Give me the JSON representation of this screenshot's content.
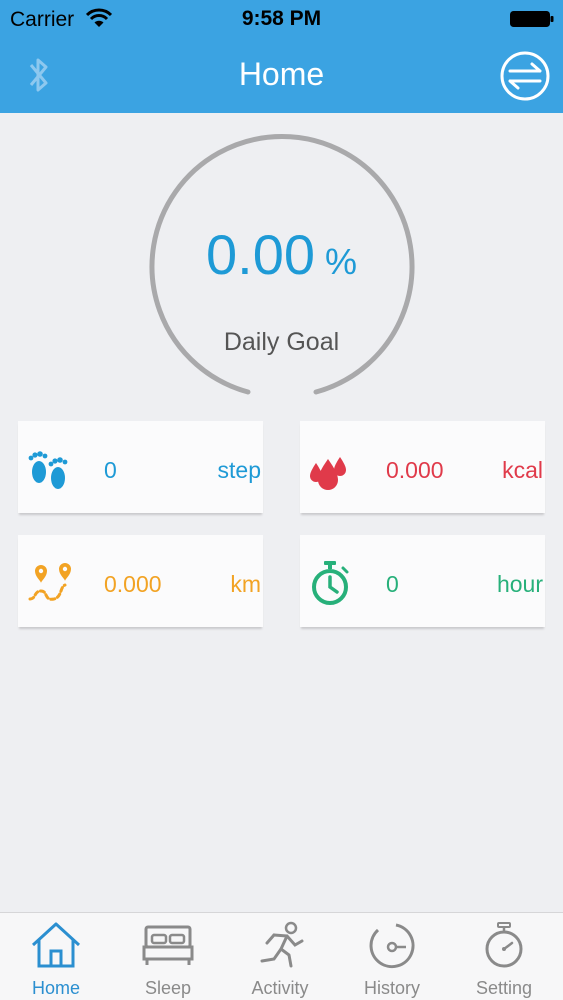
{
  "status_bar": {
    "carrier": "Carrier",
    "time": "9:58 PM"
  },
  "nav": {
    "title": "Home",
    "left_icon": "bluetooth-icon",
    "right_icon": "sync-icon"
  },
  "goal": {
    "value": "0.00",
    "unit": "%",
    "label": "Daily Goal",
    "progress": 0
  },
  "stats": {
    "steps": {
      "value": "0",
      "unit": "step",
      "icon": "footprints-icon",
      "color": "#1e9ad6"
    },
    "calories": {
      "value": "0.000",
      "unit": "kcal",
      "icon": "flame-drops-icon",
      "color": "#e03a4a"
    },
    "distance": {
      "value": "0.000",
      "unit": "km",
      "icon": "route-pin-icon",
      "color": "#f2a324"
    },
    "duration": {
      "value": "0",
      "unit": "hour",
      "icon": "stopwatch-icon",
      "color": "#27b07a"
    }
  },
  "tabs": [
    {
      "label": "Home",
      "icon": "home-icon",
      "active": true
    },
    {
      "label": "Sleep",
      "icon": "bed-icon",
      "active": false
    },
    {
      "label": "Activity",
      "icon": "runner-icon",
      "active": false
    },
    {
      "label": "History",
      "icon": "history-dial-icon",
      "active": false
    },
    {
      "label": "Setting",
      "icon": "stopwatch-setting-icon",
      "active": false
    }
  ],
  "colors": {
    "header": "#3ba3e2",
    "background": "#eeeff2",
    "active_tab": "#2b8fd0",
    "inactive_tab": "#8a8a8a"
  }
}
